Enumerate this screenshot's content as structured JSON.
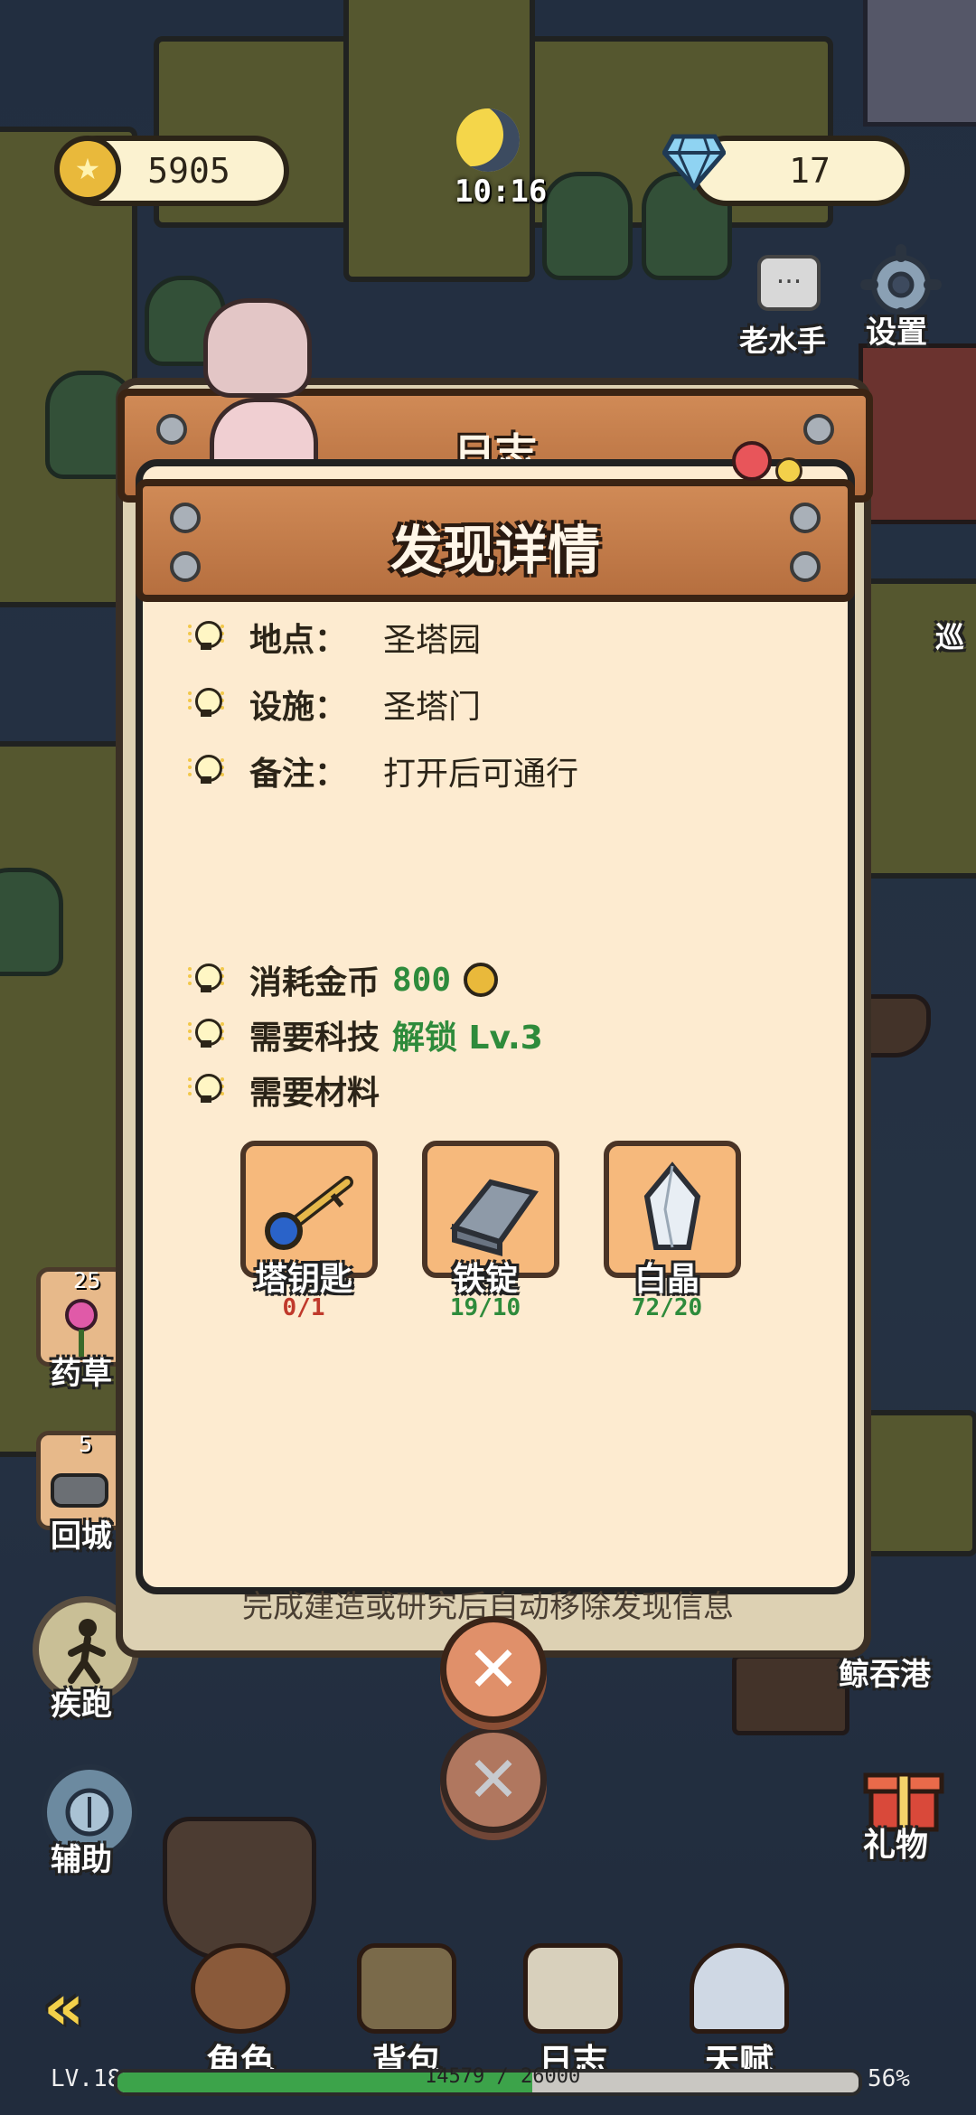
{
  "hud": {
    "coins": "5905",
    "gems": "17",
    "time": "10:16",
    "settings_label": "设置",
    "npc_label": "老水手",
    "npc_bubble": "...",
    "port_label": "鲸吞港",
    "gift_label": "礼物",
    "sign_label": "巡"
  },
  "side": {
    "herb": {
      "count": "25",
      "label": "药草"
    },
    "return": {
      "count": "5",
      "label": "回城"
    },
    "run_label": "疾跑",
    "assist_label": "辅助"
  },
  "back_dialog": {
    "title": "日志"
  },
  "dialog": {
    "title": "发现详情",
    "location_label": "地点：",
    "location_value": "圣塔园",
    "facility_label": "设施：",
    "facility_value": "圣塔门",
    "remark_label": "备注：",
    "remark_value": "打开后可通行",
    "cost_label": "消耗金币",
    "cost_value": "800",
    "tech_label": "需要科技",
    "tech_value": "解锁 Lv.3",
    "materials_label": "需要材料",
    "materials": [
      {
        "name": "塔钥匙",
        "count": "0/1",
        "status_color": "#c0392b",
        "icon": "key-icon"
      },
      {
        "name": "铁锭",
        "count": "19/10",
        "status_color": "#2e8b3b",
        "icon": "iron-ingot-icon"
      },
      {
        "name": "白晶",
        "count": "72/20",
        "status_color": "#2e8b3b",
        "icon": "white-crystal-icon"
      }
    ],
    "note": "完成建造或研究后自动移除发现信息"
  },
  "nav": {
    "items": [
      {
        "label": "角色",
        "icon": "character-icon"
      },
      {
        "label": "背包",
        "icon": "backpack-icon"
      },
      {
        "label": "日志",
        "icon": "journal-icon"
      },
      {
        "label": "天赋",
        "icon": "talent-icon"
      }
    ],
    "back_arrow": "«"
  },
  "status": {
    "level": "LV.18",
    "xp": "14579 / 26000",
    "xp_fraction": 0.56,
    "percent": "56%"
  }
}
